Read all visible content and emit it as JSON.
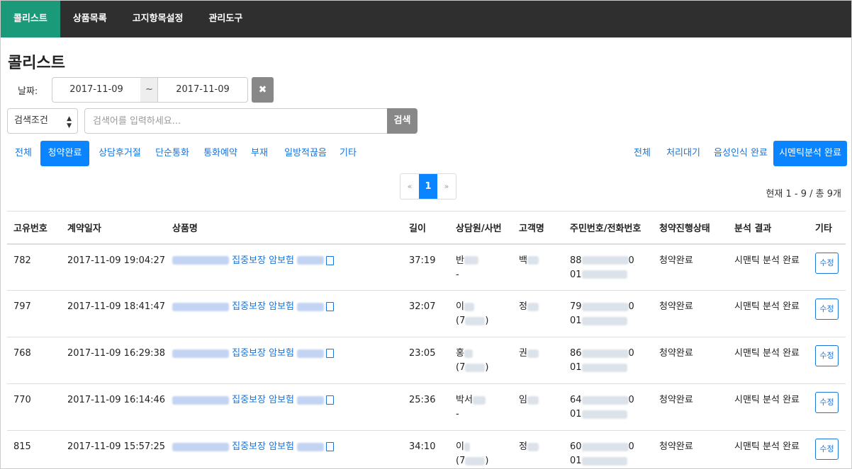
{
  "nav": {
    "items": [
      {
        "label": "콜리스트",
        "active": true
      },
      {
        "label": "상품목록",
        "active": false
      },
      {
        "label": "고지항목설정",
        "active": false
      },
      {
        "label": "관리도구",
        "active": false
      }
    ]
  },
  "page": {
    "title": "콜리스트"
  },
  "filters": {
    "date_label": "날짜:",
    "date_from": "2017-11-09",
    "date_sep": "~",
    "date_to": "2017-11-09",
    "clear_icon": "✖",
    "select_value": "검색조건",
    "search_placeholder": "검색어를 입력하세요...",
    "search_label": "검색"
  },
  "tabs_left": [
    "전체",
    "청약완료",
    "상담후거절",
    "단순통화",
    "통화예약",
    "부재",
    "일방적끊음",
    "기타"
  ],
  "tabs_right": [
    "전체",
    "처리대기",
    "음성인식 완료",
    "시멘틱분석 완료"
  ],
  "pagination": {
    "prev": "«",
    "current": "1",
    "next": "»"
  },
  "count_text": "현재 1 - 9 / 총 9개",
  "table": {
    "headers": [
      "고유번호",
      "계약일자",
      "상품명",
      "길이",
      "상담원/사번",
      "고객명",
      "주민번호/전화번호",
      "청약진행상태",
      "분석 결과",
      "기타"
    ],
    "rows": [
      {
        "id": "782",
        "date": "2017-11-09 19:04:27",
        "product": "집중보장 암보험",
        "length": "37:19",
        "agent": "반",
        "agent_sub": "-",
        "customer": "백",
        "ssn": "88",
        "ssn_end": "0",
        "phone": "01",
        "status": "청약완료",
        "result": "시맨틱 분석 완료",
        "edit": "수정"
      },
      {
        "id": "797",
        "date": "2017-11-09 18:41:47",
        "product": "집중보장 암보험",
        "length": "32:07",
        "agent": "이",
        "agent_sub": "(7",
        "customer": "정",
        "ssn": "79",
        "ssn_end": "0",
        "phone": "01",
        "status": "청약완료",
        "result": "시맨틱 분석 완료",
        "edit": "수정"
      },
      {
        "id": "768",
        "date": "2017-11-09 16:29:38",
        "product": "집중보장 암보험",
        "length": "23:05",
        "agent": "홍",
        "agent_sub": "(7",
        "customer": "권",
        "ssn": "86",
        "ssn_end": "0",
        "phone": "01",
        "status": "청약완료",
        "result": "시맨틱 분석 완료",
        "edit": "수정"
      },
      {
        "id": "770",
        "date": "2017-11-09 16:14:46",
        "product": "집중보장 암보험",
        "length": "25:36",
        "agent": "박서",
        "agent_sub": "-",
        "customer": "임",
        "ssn": "64",
        "ssn_end": "0",
        "phone": "01",
        "status": "청약완료",
        "result": "시맨틱 분석 완료",
        "edit": "수정"
      },
      {
        "id": "815",
        "date": "2017-11-09 15:57:25",
        "product": "집중보장 암보험",
        "length": "34:10",
        "agent": "이",
        "agent_sub": "(7",
        "customer": "정",
        "ssn": "60",
        "ssn_end": "0",
        "phone": "01",
        "status": "청약완료",
        "result": "시맨틱 분석 완료",
        "edit": "수정"
      }
    ]
  },
  "colors": {
    "nav_bg": "#2f2f2f",
    "nav_active": "#1b9a7a",
    "primary": "#0a84ff",
    "link": "#1a73d9"
  }
}
